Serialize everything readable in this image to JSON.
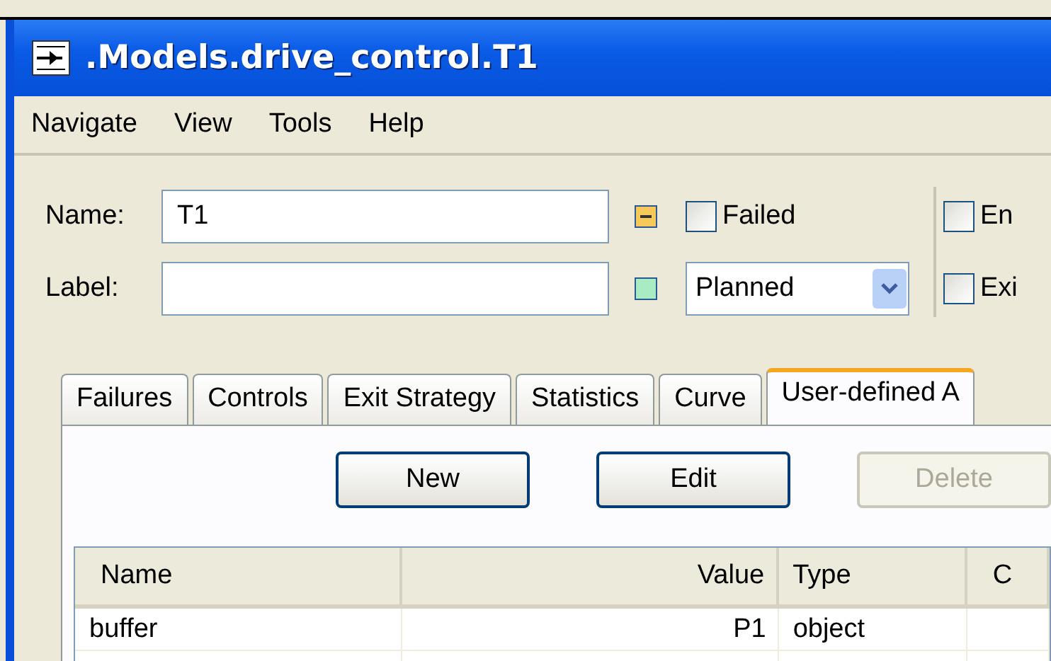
{
  "window": {
    "title": ".Models.drive_control.T1"
  },
  "menu": [
    {
      "label": "Navigate"
    },
    {
      "label": "View"
    },
    {
      "label": "Tools"
    },
    {
      "label": "Help"
    }
  ],
  "form": {
    "name": {
      "label": "Name:",
      "value": "T1"
    },
    "label": {
      "label": "Label:"
    },
    "failed": {
      "label": "Failed",
      "checked": false
    },
    "status": {
      "value": "Planned"
    },
    "right_checks": [
      {
        "label": "En",
        "checked": false
      },
      {
        "label": "Exi",
        "checked": false
      }
    ]
  },
  "tabs": [
    {
      "label": "Failures",
      "selected": false
    },
    {
      "label": "Controls",
      "selected": false
    },
    {
      "label": "Exit Strategy",
      "selected": false
    },
    {
      "label": "Statistics",
      "selected": false
    },
    {
      "label": "Curve",
      "selected": false
    },
    {
      "label": "User-defined A",
      "selected": true
    }
  ],
  "buttons": [
    {
      "label": "New",
      "disabled": false
    },
    {
      "label": "Edit",
      "disabled": false
    },
    {
      "label": "Delete",
      "disabled": true
    }
  ],
  "table": {
    "columns": [
      "Name",
      "Value",
      "Type",
      "C"
    ],
    "rows": [
      [
        "buffer",
        "P1",
        "object",
        ""
      ]
    ]
  }
}
